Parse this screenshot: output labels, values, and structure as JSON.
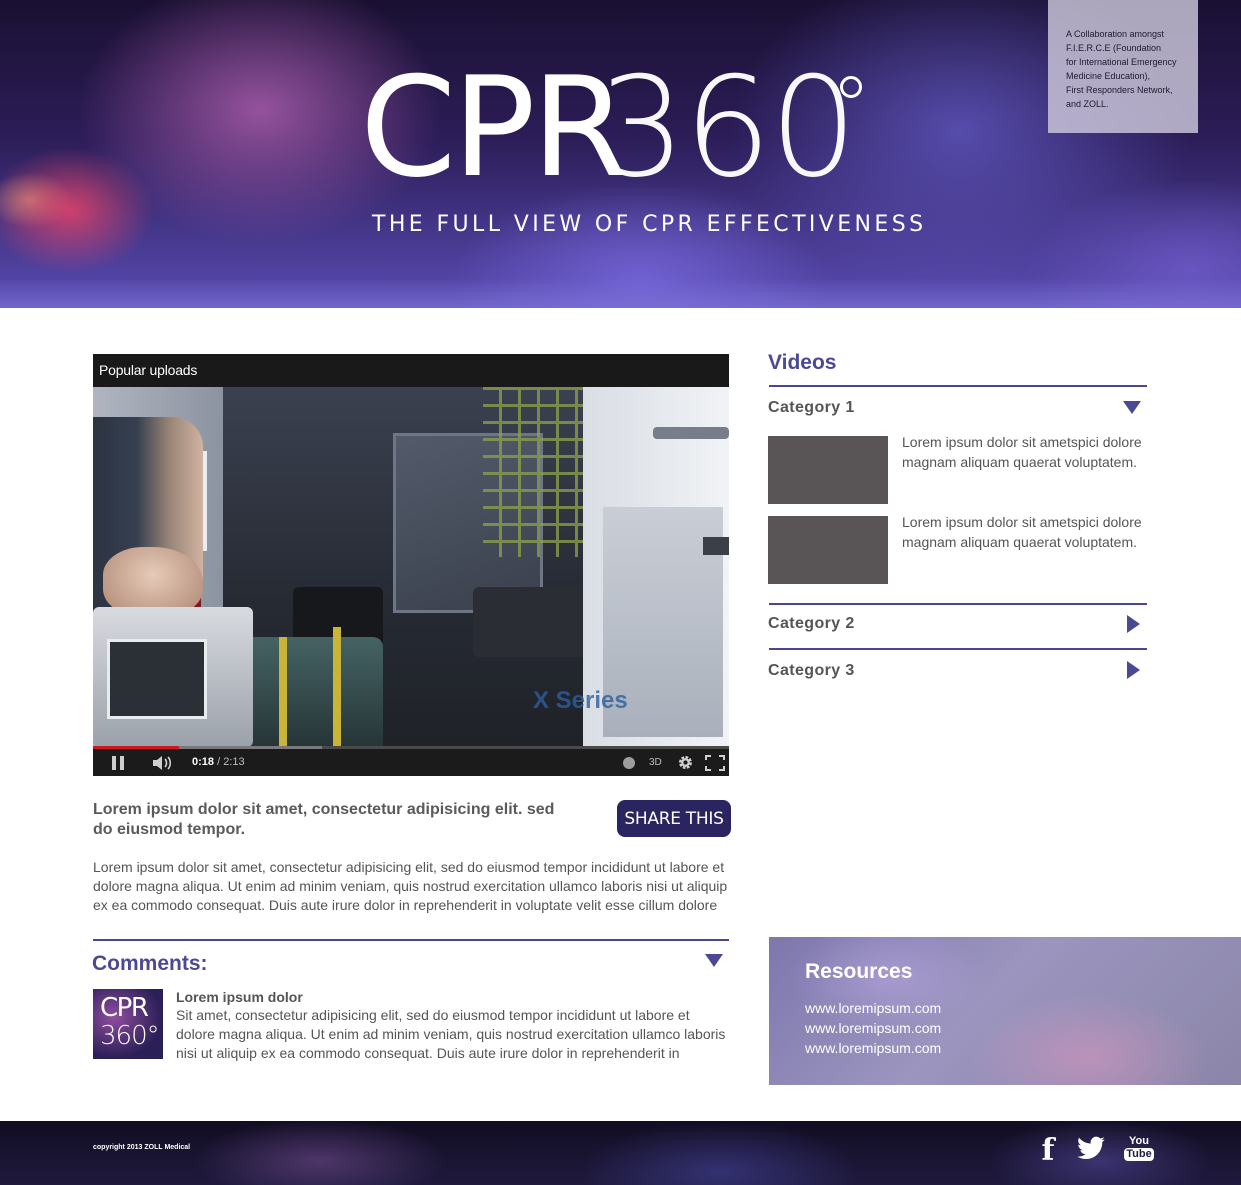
{
  "hero": {
    "logo_cpr": "CPR",
    "logo_360": "360",
    "tagline": "THE FULL VIEW OF CPR EFFECTIVENESS",
    "collab_lines": [
      "A Collaboration amongst",
      "F.I.E.R.C.E (Foundation",
      "for International Emergency",
      "Medicine Education),",
      "First Responders Network,",
      "and ZOLL."
    ]
  },
  "player": {
    "title": "Popular uploads",
    "watermark": "X Series",
    "current_time": "0:18",
    "separator": " / ",
    "duration": "2:13",
    "progress_fraction": 0.135,
    "buffer_fraction": 0.36,
    "three_d_label": "3D"
  },
  "article": {
    "headline": "Lorem ipsum dolor sit amet, consectetur adipisicing elit. sed do eiusmod tempor.",
    "share_label": "SHARE THIS",
    "body": "Lorem ipsum dolor sit amet, consectetur adipisicing elit, sed do eiusmod tempor incididunt ut labore et dolore magna aliqua. Ut enim ad minim veniam, quis nostrud exercitation ullamco laboris nisi ut aliquip ex ea commodo consequat. Duis aute irure dolor in reprehenderit in voluptate velit esse cillum dolore"
  },
  "comments": {
    "title": "Comments:",
    "items": [
      {
        "author": "Lorem ipsum dolor",
        "text": "Sit amet, consectetur adipisicing elit, sed do eiusmod tempor incididunt ut labore et dolore magna aliqua. Ut enim ad minim veniam, quis nostrud exercitation ullamco laboris nisi ut aliquip ex ea commodo consequat. Duis aute irure dolor in reprehenderit in",
        "avatar_line1": "CPR",
        "avatar_line2": "360°"
      }
    ]
  },
  "videos": {
    "title": "Videos",
    "categories": [
      {
        "label": "Category 1",
        "expanded": true,
        "items": [
          {
            "text": "Lorem ipsum dolor sit ametspici dolore magnam aliquam quaerat voluptatem."
          },
          {
            "text": "Lorem ipsum dolor sit ametspici dolore magnam aliquam quaerat voluptatem."
          }
        ]
      },
      {
        "label": "Category 2",
        "expanded": false
      },
      {
        "label": "Category 3",
        "expanded": false
      }
    ]
  },
  "resources": {
    "title": "Resources",
    "links": [
      "www.loremipsum.com",
      "www.loremipsum.com",
      "www.loremipsum.com"
    ]
  },
  "footer": {
    "copyright": "copyright 2013 ZOLL Medical",
    "social": [
      {
        "icon": "facebook-icon",
        "glyph": "f"
      },
      {
        "icon": "twitter-icon"
      },
      {
        "icon": "youtube-icon",
        "line1": "You",
        "line2": "Tube"
      }
    ]
  },
  "colors": {
    "accent": "#4c4994",
    "share_button": "#2a2560",
    "text": "#555555",
    "progress": "#cc181e"
  }
}
